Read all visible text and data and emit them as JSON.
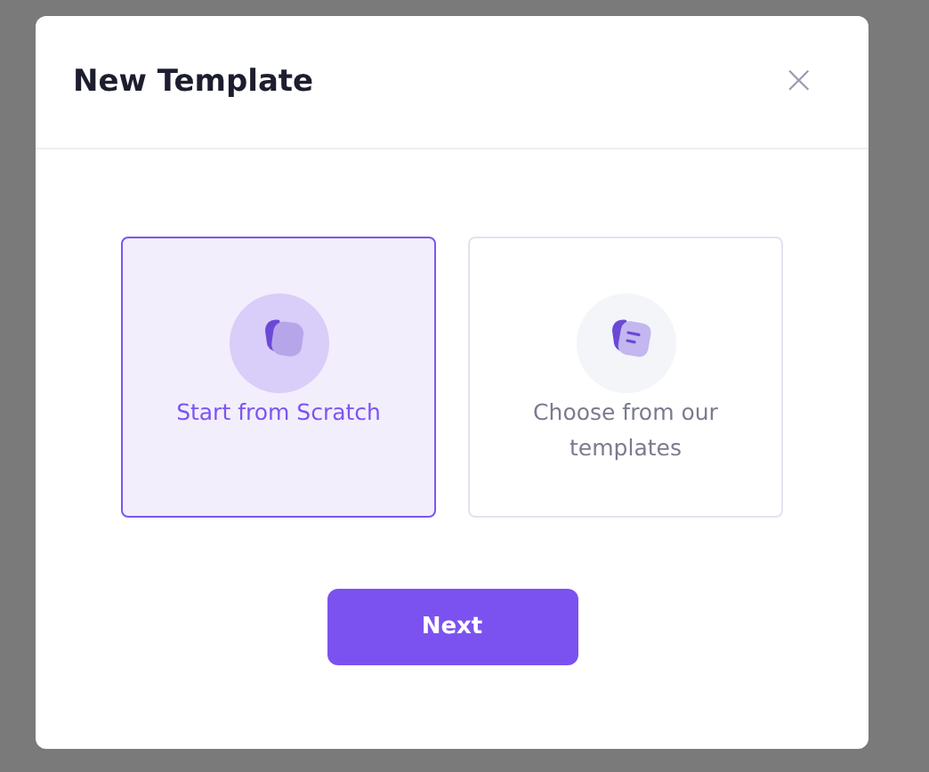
{
  "dialog": {
    "title": "New Template",
    "close": "×"
  },
  "options": [
    {
      "kind": "blank",
      "label": "Start from Scratch",
      "selected": true
    },
    {
      "kind": "template",
      "label": "Choose from our templates",
      "selected": false
    }
  ],
  "button": "Next"
}
